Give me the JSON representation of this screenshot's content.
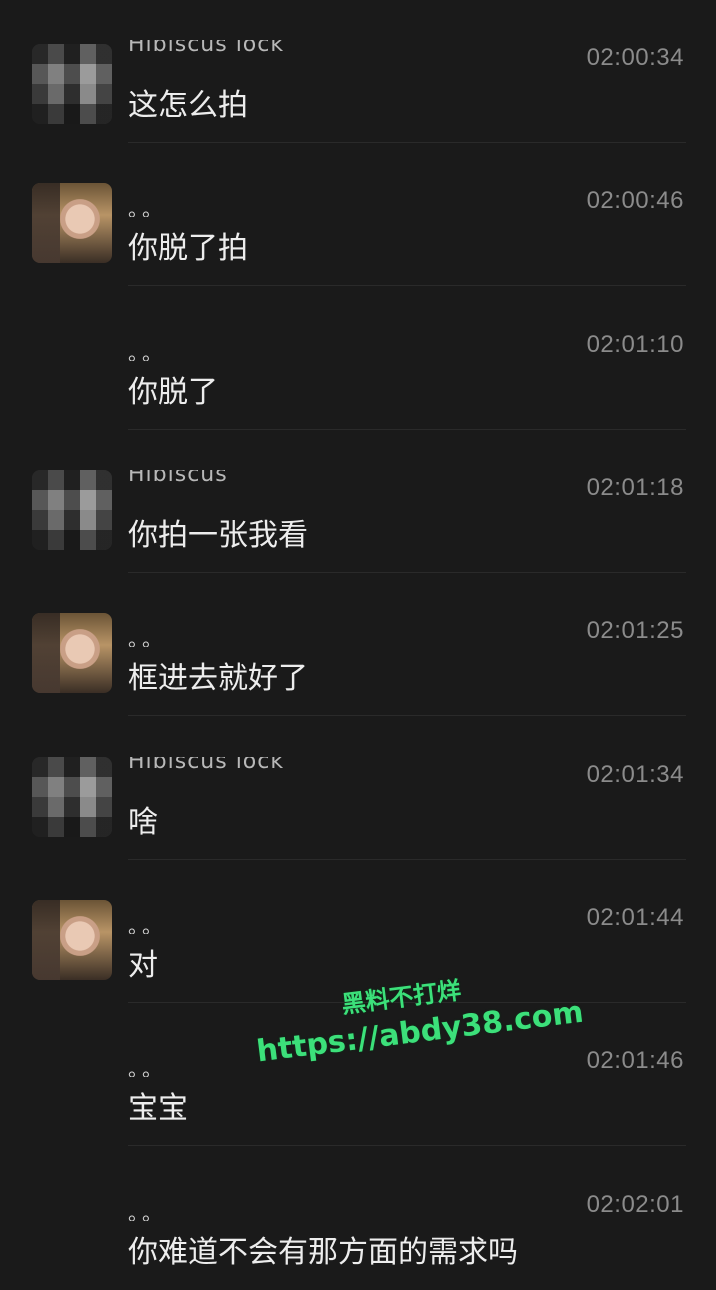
{
  "messages": [
    {
      "name": "Hibiscus lock",
      "time": "02:00:34",
      "text": "这怎么拍",
      "avatar": "blurred",
      "name_style": "cut"
    },
    {
      "name": "。。",
      "time": "02:00:46",
      "text": "你脱了拍",
      "avatar": "girl",
      "name_style": "dots"
    },
    {
      "name": "。。",
      "time": "02:01:10",
      "text": "你脱了",
      "avatar": "none",
      "name_style": "dots"
    },
    {
      "name": "Hibiscus",
      "time": "02:01:18",
      "text": "你拍一张我看",
      "avatar": "blurred",
      "name_style": "cut"
    },
    {
      "name": "。。",
      "time": "02:01:25",
      "text": "框进去就好了",
      "avatar": "girl",
      "name_style": "dots"
    },
    {
      "name": "Hibiscus lock",
      "time": "02:01:34",
      "text": "啥",
      "avatar": "blurred",
      "name_style": "cut"
    },
    {
      "name": "。。",
      "time": "02:01:44",
      "text": "对",
      "avatar": "girl",
      "name_style": "dots"
    },
    {
      "name": "。。",
      "time": "02:01:46",
      "text": "宝宝",
      "avatar": "none",
      "name_style": "dots"
    },
    {
      "name": "。。",
      "time": "02:02:01",
      "text": "你难道不会有那方面的需求吗",
      "avatar": "none",
      "name_style": "dots"
    }
  ],
  "watermark": {
    "line1": "黑料不打烊",
    "line2": "https://abdy38.com"
  }
}
